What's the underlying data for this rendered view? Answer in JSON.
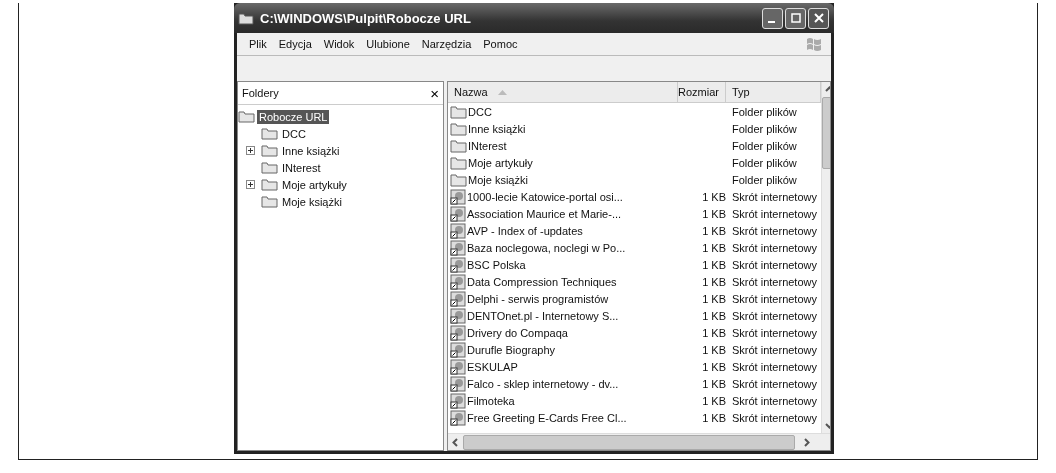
{
  "window": {
    "title": "C:\\WINDOWS\\Pulpit\\Robocze URL"
  },
  "menu": [
    "Plik",
    "Edycja",
    "Widok",
    "Ulubione",
    "Narzędzia",
    "Pomoc"
  ],
  "folders_pane": {
    "title": "Foldery",
    "close": "×",
    "tree": [
      {
        "label": "Robocze URL",
        "selected": true,
        "expandable": false,
        "children": [
          {
            "label": "DCC",
            "selected": false,
            "expandable": false
          },
          {
            "label": "Inne książki",
            "selected": false,
            "expandable": true
          },
          {
            "label": "INterest",
            "selected": false,
            "expandable": false
          },
          {
            "label": "Moje artykuły",
            "selected": false,
            "expandable": true
          },
          {
            "label": "Moje książki",
            "selected": false,
            "expandable": false
          }
        ]
      }
    ]
  },
  "table": {
    "columns": [
      "Nazwa",
      "Rozmiar",
      "Typ"
    ],
    "rows": [
      {
        "kind": "folder",
        "name": "DCC",
        "type": "Folder plików"
      },
      {
        "kind": "folder",
        "name": "Inne książki",
        "type": "Folder plików"
      },
      {
        "kind": "folder",
        "name": "INterest",
        "type": "Folder plików"
      },
      {
        "kind": "folder",
        "name": "Moje artykuły",
        "type": "Folder plików"
      },
      {
        "kind": "folder",
        "name": "Moje książki",
        "type": "Folder plików"
      },
      {
        "kind": "shortcut",
        "name": "1000-lecie Katowice-portal osi...",
        "size": "1 KB",
        "type": "Skrót internetowy"
      },
      {
        "kind": "shortcut",
        "name": "Association Maurice et Marie-...",
        "size": "1 KB",
        "type": "Skrót internetowy"
      },
      {
        "kind": "shortcut",
        "name": "AVP - Index of -updates",
        "size": "1 KB",
        "type": "Skrót internetowy"
      },
      {
        "kind": "shortcut",
        "name": "Baza noclegowa, noclegi w Po...",
        "size": "1 KB",
        "type": "Skrót internetowy"
      },
      {
        "kind": "shortcut",
        "name": "BSC Polska",
        "size": "1 KB",
        "type": "Skrót internetowy"
      },
      {
        "kind": "shortcut",
        "name": "Data Compression Techniques",
        "size": "1 KB",
        "type": "Skrót internetowy"
      },
      {
        "kind": "shortcut",
        "name": "Delphi - serwis programistów",
        "size": "1 KB",
        "type": "Skrót internetowy"
      },
      {
        "kind": "shortcut",
        "name": "DENTOnet.pl - Internetowy S...",
        "size": "1 KB",
        "type": "Skrót internetowy"
      },
      {
        "kind": "shortcut",
        "name": "Drivery do Compaqa",
        "size": "1 KB",
        "type": "Skrót internetowy"
      },
      {
        "kind": "shortcut",
        "name": "Durufle Biography",
        "size": "1 KB",
        "type": "Skrót internetowy"
      },
      {
        "kind": "shortcut",
        "name": "ESKULAP",
        "size": "1 KB",
        "type": "Skrót internetowy"
      },
      {
        "kind": "shortcut",
        "name": "Falco - sklep internetowy - dv...",
        "size": "1 KB",
        "type": "Skrót internetowy"
      },
      {
        "kind": "shortcut",
        "name": "Filmoteka",
        "size": "1 KB",
        "type": "Skrót internetowy"
      },
      {
        "kind": "shortcut",
        "name": "Free Greeting E-Cards Free Cl...",
        "size": "1 KB",
        "type": "Skrót internetowy"
      }
    ]
  }
}
